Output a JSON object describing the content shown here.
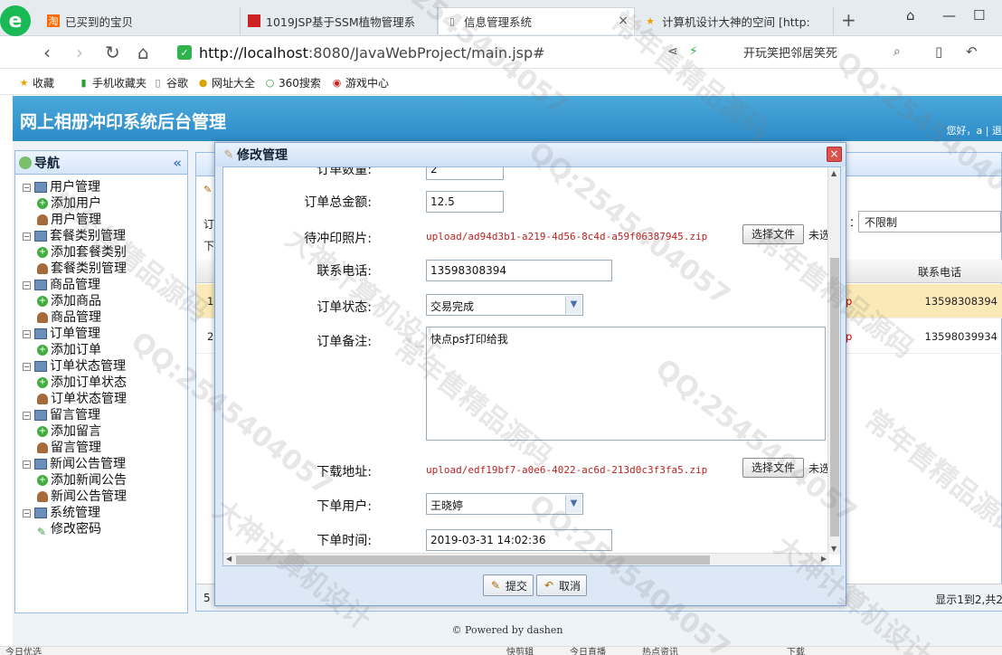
{
  "browser": {
    "tabs": [
      {
        "label": "已买到的宝贝",
        "icon": "taobao-icon"
      },
      {
        "label": "1019JSP基于SSM植物管理系",
        "icon": "red-square-icon"
      },
      {
        "label": "信息管理系统",
        "icon": "page-icon",
        "active": true
      },
      {
        "label": "计算机设计大神的空间 [http:",
        "icon": "star-icon"
      }
    ],
    "url_host": "http://localhost",
    "url_path": ":8080/JavaWebProject/main.jsp#",
    "search_text": "开玩笑把邻居笑死",
    "bookmarks": [
      "收藏",
      "手机收藏夹",
      "谷歌",
      "网址大全",
      "360搜索",
      "游戏中心"
    ]
  },
  "app": {
    "title": "网上相册冲印系统后台管理",
    "greeting": "您好，a | 退",
    "footer": "© Powered by dashen"
  },
  "sidebar": {
    "title": "导航",
    "groups": [
      {
        "label": "用户管理",
        "children": [
          {
            "label": "添加用户",
            "type": "add"
          },
          {
            "label": "用户管理",
            "type": "user"
          }
        ]
      },
      {
        "label": "套餐类别管理",
        "children": [
          {
            "label": "添加套餐类别",
            "type": "add"
          },
          {
            "label": "套餐类别管理",
            "type": "user"
          }
        ]
      },
      {
        "label": "商品管理",
        "children": [
          {
            "label": "添加商品",
            "type": "add"
          },
          {
            "label": "商品管理",
            "type": "user"
          }
        ]
      },
      {
        "label": "订单管理",
        "children": [
          {
            "label": "添加订单",
            "type": "add"
          },
          {
            "label": "订单管理",
            "type": "user",
            "selected": true
          }
        ]
      },
      {
        "label": "订单状态管理",
        "children": [
          {
            "label": "添加订单状态",
            "type": "add"
          },
          {
            "label": "订单状态管理",
            "type": "user"
          }
        ]
      },
      {
        "label": "留言管理",
        "children": [
          {
            "label": "添加留言",
            "type": "add"
          },
          {
            "label": "留言管理",
            "type": "user"
          }
        ]
      },
      {
        "label": "新闻公告管理",
        "children": [
          {
            "label": "添加新闻公告",
            "type": "add"
          },
          {
            "label": "新闻公告管理",
            "type": "user"
          }
        ]
      },
      {
        "label": "系统管理",
        "children": [
          {
            "label": "修改密码",
            "type": "pen"
          }
        ]
      }
    ]
  },
  "main": {
    "filter_label": "：",
    "filter_value": "不限制",
    "column_phone": "联系电话",
    "rows": [
      {
        "num": "1",
        "phone": "13598308394",
        "mark": "p"
      },
      {
        "num": "2",
        "phone": "13598039934",
        "mark": "p"
      }
    ],
    "pager_info": "显示1到2,共2",
    "pager_page": "5",
    "left_labels": [
      "订",
      "下"
    ]
  },
  "modal": {
    "title": "修改管理",
    "fields": {
      "order_count_label": "订单数量:",
      "order_count_value": "2",
      "order_total_label": "订单总金额:",
      "order_total_value": "12.5",
      "photo_label": "待冲印照片:",
      "photo_file": "upload/ad94d3b1-a219-4d56-8c4d-a59f06387945.zip",
      "phone_label": "联系电话:",
      "phone_value": "13598308394",
      "status_label": "订单状态:",
      "status_value": "交易完成",
      "remark_label": "订单备注:",
      "remark_value": "快点ps打印给我",
      "download_label": "下载地址:",
      "download_file": "upload/edf19bf7-a0e6-4022-ac6d-213d0c3f3fa5.zip",
      "user_label": "下单用户:",
      "user_value": "王晓婷",
      "time_label": "下单时间:",
      "time_value": "2019-03-31 14:02:36"
    },
    "choose_file_label": "选择文件",
    "no_file_label": "未选",
    "submit_label": "提交",
    "cancel_label": "取消"
  },
  "statusbar": {
    "left": "今日优选",
    "items": [
      "快剪辑",
      "今日直播",
      "热点资讯",
      "下载"
    ]
  },
  "watermark": {
    "texts": [
      "QQ:2545404057",
      "常年售精品源码",
      "大神计算机设计"
    ]
  }
}
